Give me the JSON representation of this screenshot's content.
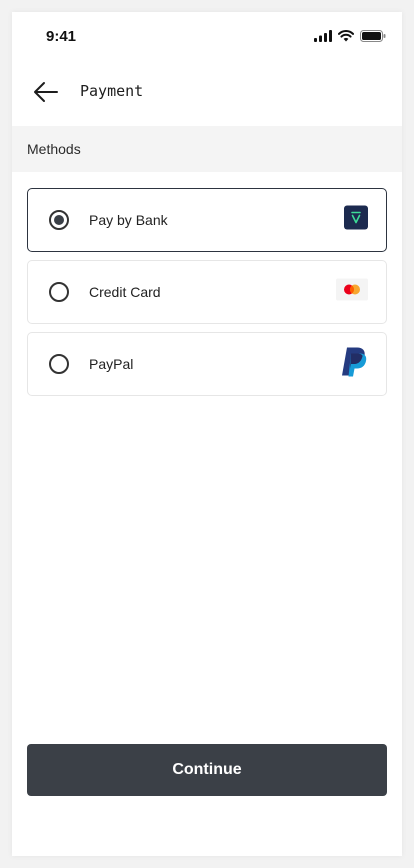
{
  "status_bar": {
    "time": "9:41",
    "icons": [
      "signal-icon",
      "wifi-icon",
      "battery-icon"
    ]
  },
  "header": {
    "back_icon": "arrow-left-icon",
    "title": "Payment"
  },
  "section": {
    "label": "Methods"
  },
  "methods": [
    {
      "label": "Pay by Bank",
      "selected": true,
      "logo": "bank-logo-icon"
    },
    {
      "label": "Credit Card",
      "selected": false,
      "logo": "mastercard-icon"
    },
    {
      "label": "PayPal",
      "selected": false,
      "logo": "paypal-icon"
    }
  ],
  "actions": {
    "continue_label": "Continue"
  },
  "colors": {
    "primary_button": "#3b4047",
    "selected_border": "#2d3440",
    "section_bg": "#f4f4f4",
    "bank_logo_bg": "#1c2a4f",
    "bank_logo_accent": "#3ddc97"
  }
}
